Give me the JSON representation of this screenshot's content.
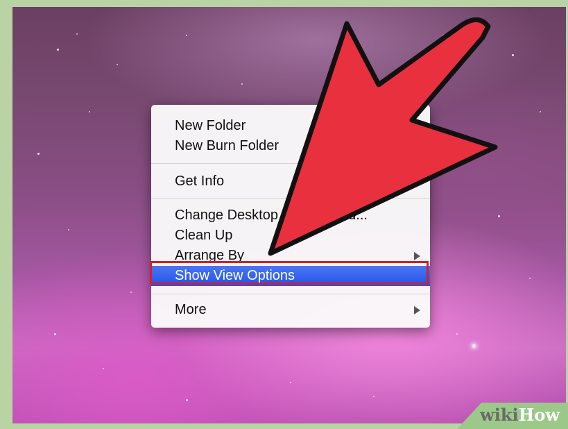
{
  "context_menu": {
    "items": [
      {
        "label": "New Folder"
      },
      {
        "label": "New Burn Folder"
      },
      {
        "label": "Get Info"
      },
      {
        "label": "Change Desktop Background..."
      },
      {
        "label": "Clean Up"
      },
      {
        "label": "Arrange By",
        "has_submenu": true
      },
      {
        "label": "Show View Options",
        "selected": true
      },
      {
        "label": "More",
        "has_submenu": true
      }
    ]
  },
  "annotation": {
    "arrow_color": "#e8303f",
    "highlight_color": "#d0202c"
  },
  "watermark": {
    "part1": "wiki",
    "part2": "How"
  },
  "colors": {
    "selection": "#2f5ff0",
    "desktop": "#8a4e85"
  }
}
